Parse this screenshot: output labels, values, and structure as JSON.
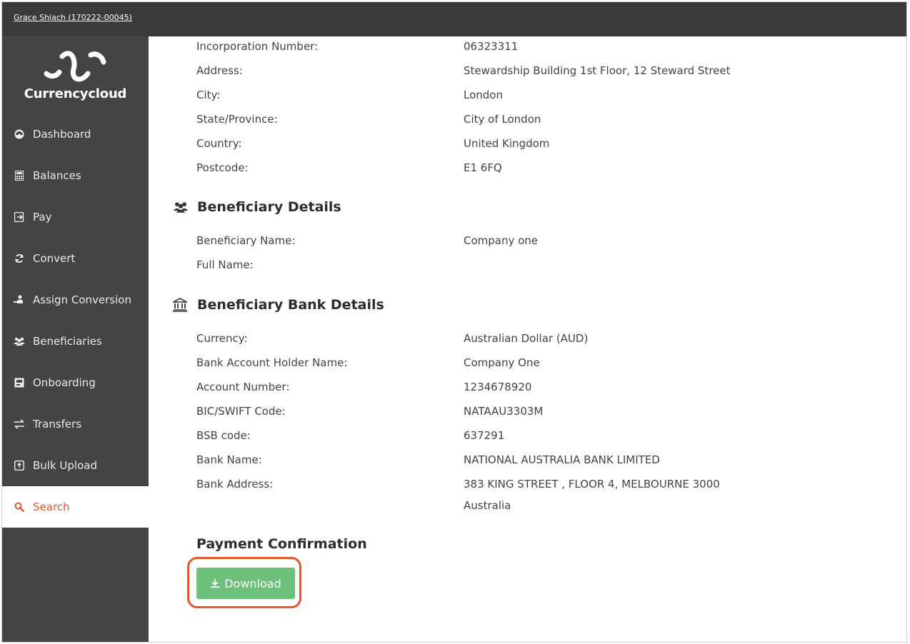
{
  "topbar": {
    "user": "Grace Shiach (170222-00045)"
  },
  "brand": {
    "name": "Currencycloud"
  },
  "nav": [
    {
      "label": "Dashboard",
      "icon": "dashboard-icon"
    },
    {
      "label": "Balances",
      "icon": "calculator-icon"
    },
    {
      "label": "Pay",
      "icon": "pay-icon"
    },
    {
      "label": "Convert",
      "icon": "refresh-icon"
    },
    {
      "label": "Assign Conversion",
      "icon": "assign-icon"
    },
    {
      "label": "Beneficiaries",
      "icon": "users-icon"
    },
    {
      "label": "Onboarding",
      "icon": "onboarding-icon"
    },
    {
      "label": "Transfers",
      "icon": "transfer-arrows-icon"
    },
    {
      "label": "Bulk Upload",
      "icon": "upload-icon"
    },
    {
      "label": "Search",
      "icon": "search-icon",
      "active": true
    }
  ],
  "address": [
    {
      "label": "Incorporation Number:",
      "value": "06323311"
    },
    {
      "label": "Address:",
      "value": "Stewardship Building 1st Floor, 12 Steward Street"
    },
    {
      "label": "City:",
      "value": "London"
    },
    {
      "label": "State/Province:",
      "value": "City of London"
    },
    {
      "label": "Country:",
      "value": "United Kingdom"
    },
    {
      "label": "Postcode:",
      "value": "E1 6FQ"
    }
  ],
  "beneficiary": {
    "title": "Beneficiary Details",
    "rows": [
      {
        "label": "Beneficiary Name:",
        "value": "Company one"
      },
      {
        "label": "Full Name:",
        "value": ""
      }
    ]
  },
  "bank": {
    "title": "Beneficiary Bank Details",
    "rows": [
      {
        "label": "Currency:",
        "value": "Australian Dollar (AUD)"
      },
      {
        "label": "Bank Account Holder Name:",
        "value": "Company One"
      },
      {
        "label": "Account Number:",
        "value": "1234678920"
      },
      {
        "label": "BIC/SWIFT Code:",
        "value": "NATAAU3303M"
      },
      {
        "label": "BSB code:",
        "value": "637291"
      },
      {
        "label": "Bank Name:",
        "value": "NATIONAL AUSTRALIA BANK LIMITED"
      },
      {
        "label": "Bank Address:",
        "value": "383 KING STREET , FLOOR 4, MELBOURNE 3000",
        "value2": "Australia"
      }
    ]
  },
  "payment": {
    "title": "Payment Confirmation",
    "download_label": "Download"
  },
  "colors": {
    "accent": "#e3582d",
    "download": "#6cc07a",
    "sidebar": "#444444",
    "topbar": "#3a3a3a"
  }
}
